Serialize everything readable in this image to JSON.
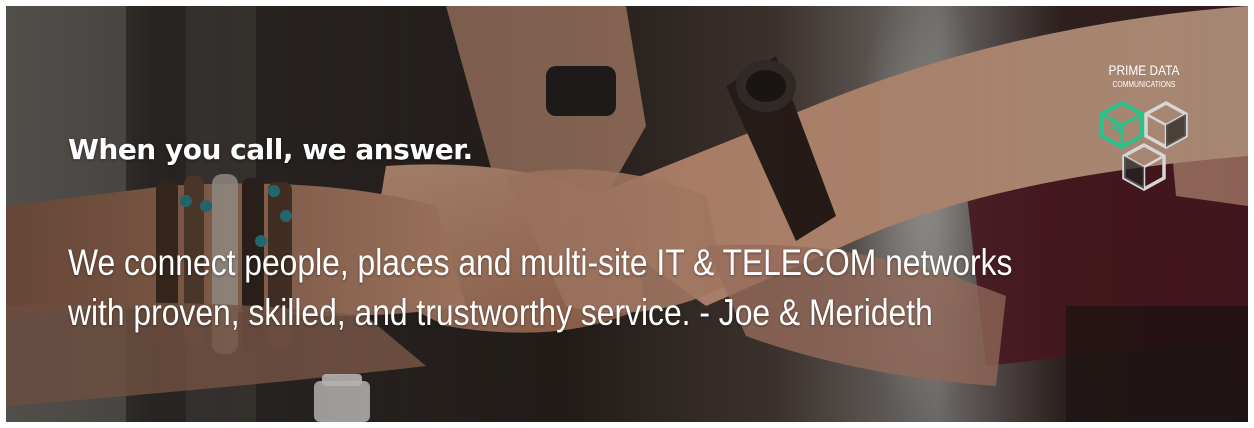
{
  "hero": {
    "headline": "When you call, we answer.",
    "tagline_line1": "We connect people, places and multi-site IT & TELECOM networks",
    "tagline_line2": "with proven, skilled, and trustworthy service. - Joe & Merideth"
  },
  "logo": {
    "name": "PRIME DATA",
    "subtitle": "COMMUNICATIONS",
    "icon": "hexagon-cubes-icon",
    "accent_color": "#27c38a"
  },
  "background": {
    "image": "team-fist-bump-photo",
    "text_color": "#ffffff"
  }
}
